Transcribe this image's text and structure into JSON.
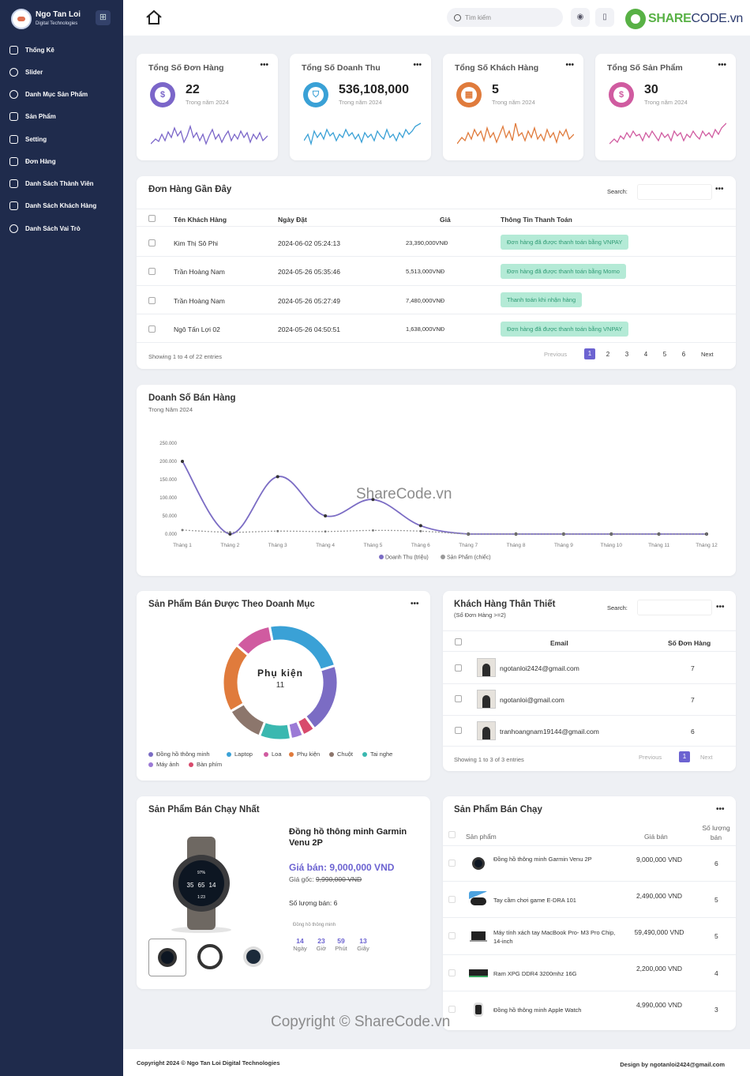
{
  "sidebar": {
    "brand_title": "Ngo Tan Loi",
    "brand_subtitle": "Digital Technologies",
    "items": [
      {
        "label": "Thống Kê"
      },
      {
        "label": "Slider"
      },
      {
        "label": "Danh Mục Sản Phẩm"
      },
      {
        "label": "Sản Phẩm"
      },
      {
        "label": "Setting"
      },
      {
        "label": "Đơn Hàng"
      },
      {
        "label": "Danh Sách Thành Viên"
      },
      {
        "label": "Danh Sách Khách Hàng"
      },
      {
        "label": "Danh Sách Vai Trò"
      }
    ]
  },
  "topbar": {
    "search_placeholder": "Tìm kiếm",
    "watermark_a": "SHARE",
    "watermark_b": "CODE.vn"
  },
  "stats": [
    {
      "title": "Tổng Số Đơn Hàng",
      "value": "22",
      "sub": "Trong năm 2024",
      "icon": "dollar-icon",
      "color": "#7b66c9"
    },
    {
      "title": "Tổng Số Doanh Thu",
      "value": "536,108,000",
      "sub": "Trong năm 2024",
      "icon": "basket-icon",
      "color": "#3aa1d6"
    },
    {
      "title": "Tổng Số Khách Hàng",
      "value": "5",
      "sub": "Trong năm 2024",
      "icon": "calendar-icon",
      "color": "#e07b3c"
    },
    {
      "title": "Tổng Số Sản Phẩm",
      "value": "30",
      "sub": "Trong năm 2024",
      "icon": "refund-icon",
      "color": "#d05ba0"
    }
  ],
  "orders": {
    "title": "Đơn Hàng Gần Đây",
    "search_label": "Search:",
    "headers": [
      "Tên Khách Hàng",
      "Ngày Đặt",
      "Giá",
      "Thông Tin Thanh Toán"
    ],
    "rows": [
      {
        "name": "Kim Thị Sô Phi",
        "date": "2024-06-02 05:24:13",
        "price": "23,390,000VNĐ",
        "payment": "Đơn hàng đã được thanh toán bằng VNPAY"
      },
      {
        "name": "Trần Hoàng Nam",
        "date": "2024-05-26 05:35:46",
        "price": "5,513,000VNĐ",
        "payment": "Đơn hàng đã được thanh toán bằng Momo"
      },
      {
        "name": "Trần Hoàng Nam",
        "date": "2024-05-26 05:27:49",
        "price": "7,480,000VNĐ",
        "payment": "Thanh toán khi nhận hàng"
      },
      {
        "name": "Ngô Tấn Lợi 02",
        "date": "2024-05-26 04:50:51",
        "price": "1,638,000VNĐ",
        "payment": "Đơn hàng đã được thanh toán bằng VNPAY"
      }
    ],
    "showing": "Showing 1 to 4 of 22 entries",
    "pager": [
      "Previous",
      "1",
      "2",
      "3",
      "4",
      "5",
      "6",
      "Next"
    ]
  },
  "sales": {
    "title": "Doanh Số Bán Hàng",
    "subtitle": "Trong Năm 2024",
    "overlay": "ShareCode.vn"
  },
  "chart_data": {
    "type": "line",
    "categories": [
      "Tháng 1",
      "Tháng 2",
      "Tháng 3",
      "Tháng 4",
      "Tháng 5",
      "Tháng 6",
      "Tháng 7",
      "Tháng 8",
      "Tháng 9",
      "Tháng 10",
      "Tháng 11",
      "Tháng 12"
    ],
    "yticks": [
      "0.000",
      "50.000",
      "100.000",
      "150.000",
      "200.000",
      "250.000"
    ],
    "ylim": [
      0,
      250
    ],
    "series": [
      {
        "name": "Doanh Thu (triệu)",
        "color": "#7b6cc4",
        "values": [
          200,
          0,
          158,
          50,
          95,
          23,
          0,
          0,
          0,
          0,
          0,
          0
        ]
      },
      {
        "name": "Sản Phẩm (chiếc)",
        "color": "#999999",
        "values": [
          11,
          5,
          8,
          7,
          10,
          8,
          0,
          0,
          0,
          0,
          0,
          0
        ]
      }
    ],
    "legend": "bottom"
  },
  "category_sales": {
    "title": "Sản Phẩm Bán Được Theo Doanh Mục",
    "center_label": "Phụ kiện",
    "center_value": "11",
    "segments": [
      {
        "name": "Đồng hồ thông minh",
        "value": 11,
        "color": "#7b6cc4"
      },
      {
        "name": "Laptop",
        "value": 13,
        "color": "#3aa1d6"
      },
      {
        "name": "Loa",
        "value": 6,
        "color": "#d05ba0"
      },
      {
        "name": "Phụ kiện",
        "value": 11,
        "color": "#e07b3c"
      },
      {
        "name": "Chuột",
        "value": 6,
        "color": "#8c766c"
      },
      {
        "name": "Tai nghe",
        "value": 5,
        "color": "#3ab8b0"
      },
      {
        "name": "Máy ảnh",
        "value": 2,
        "color": "#9c7ad6"
      },
      {
        "name": "Bàn phím",
        "value": 2,
        "color": "#d84a6c"
      }
    ]
  },
  "loyal": {
    "title": "Khách Hàng Thân Thiết",
    "subtitle": "(Số Đơn Hàng >=2)",
    "search_label": "Search:",
    "headers": [
      "Email",
      "Số Đơn Hàng"
    ],
    "rows": [
      {
        "email": "ngotanloi2424@gmail.com",
        "count": "7"
      },
      {
        "email": "ngotanloi@gmail.com",
        "count": "7"
      },
      {
        "email": "tranhoangnam19144@gmail.com",
        "count": "6"
      }
    ],
    "showing": "Showing 1 to 3 of 3 entries",
    "pager": [
      "Previous",
      "1",
      "Next"
    ]
  },
  "best": {
    "title": "Sản Phẩm Bán Chạy Nhất",
    "product_name": "Đồng hồ thông minh Garmin Venu 2P",
    "price_label": "Giá bán: 9,000,000 VND",
    "orig_label": "Giá gốc:",
    "orig_price": "9,990,000 VND",
    "sold": "Số lượng bán: 6",
    "category": "Đồng hồ thông minh",
    "watch_face": [
      "97%",
      "35",
      "65",
      "14",
      "1:23"
    ],
    "countdown": [
      {
        "v": "14",
        "l": "Ngày"
      },
      {
        "v": "23",
        "l": "Giờ"
      },
      {
        "v": "59",
        "l": "Phút"
      },
      {
        "v": "13",
        "l": "Giây"
      }
    ]
  },
  "top_products": {
    "title": "Sản Phẩm Bán Chạy",
    "headers": [
      "Sản phẩm",
      "Giá bán",
      "Số lượng bán"
    ],
    "rows": [
      {
        "name": "Đồng hồ thông minh Garmin Venu 2P",
        "price": "9,000,000 VND",
        "qty": "6",
        "icon": "watch-icon"
      },
      {
        "name": "Tay cầm chơi game E-DRA 101",
        "price": "2,490,000 VND",
        "qty": "5",
        "icon": "gamepad-icon"
      },
      {
        "name": "Máy tính xách tay MacBook Pro- M3 Pro Chip, 14-inch",
        "price": "59,490,000 VND",
        "qty": "5",
        "icon": "laptop-icon"
      },
      {
        "name": "Ram XPG DDR4 3200mhz 16G",
        "price": "2,200,000 VND",
        "qty": "4",
        "icon": "ram-icon"
      },
      {
        "name": "Đồng hồ thông minh Apple Watch",
        "price": "4,990,000 VND",
        "qty": "3",
        "icon": "watch-icon"
      }
    ]
  },
  "footer": {
    "left": "Copyright 2024 © Ngo Tan Loi Digital Technologies",
    "right": "Design by ngotanloi2424@gmail.com",
    "overlay": "Copyright © ShareCode.vn"
  }
}
